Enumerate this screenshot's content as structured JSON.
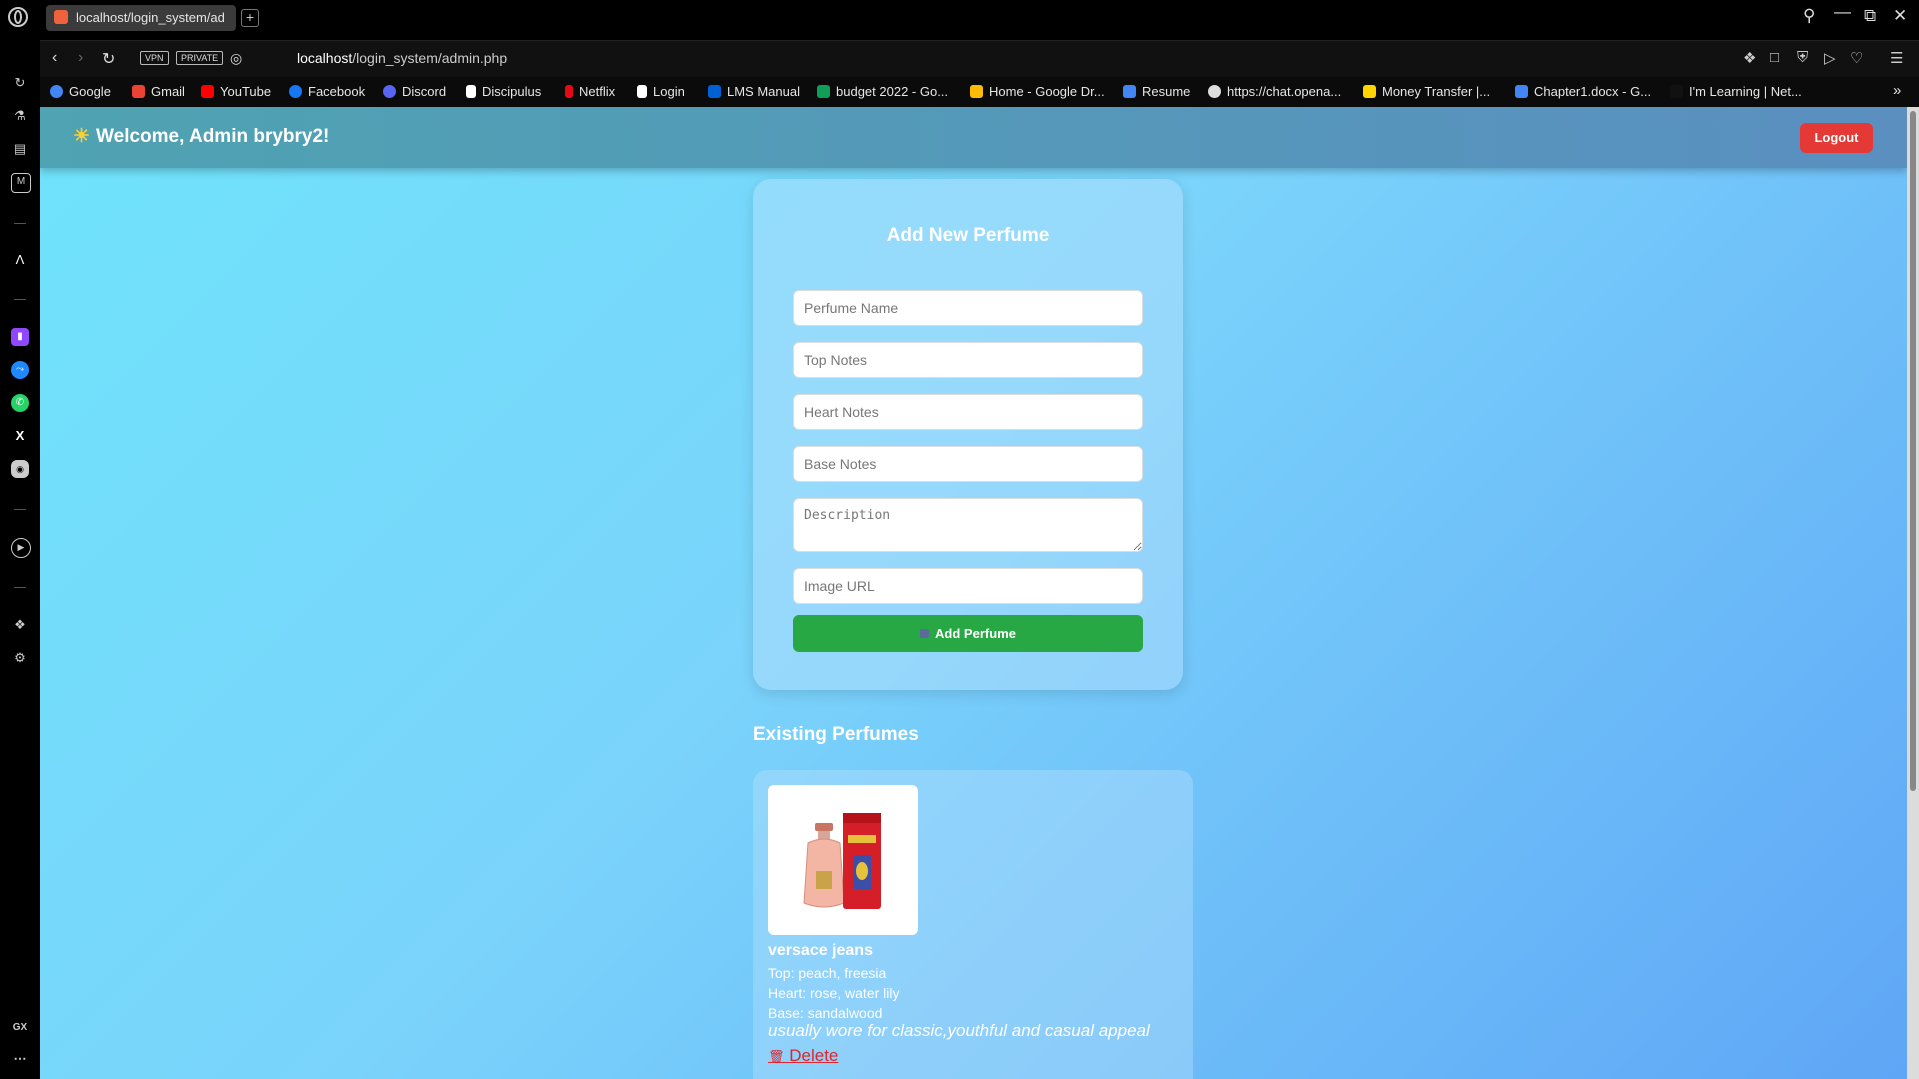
{
  "browser": {
    "tab_title": "localhost/login_system/ad",
    "new_tab": "+",
    "url_host": "localhost",
    "url_path": "/login_system/admin.php",
    "vpn_badge": "VPN",
    "private_badge": "PRIVATE",
    "bookmarks": [
      {
        "label": "Google",
        "color": "#4285f4"
      },
      {
        "label": "Gmail",
        "color": "#ea4335"
      },
      {
        "label": "YouTube",
        "color": "#ff0000"
      },
      {
        "label": "Facebook",
        "color": "#1877f2"
      },
      {
        "label": "Discord",
        "color": "#5865f2"
      },
      {
        "label": "Discipulus",
        "color": "#ffffff"
      },
      {
        "label": "Netflix",
        "color": "#e50914"
      },
      {
        "label": "Login",
        "color": "#ffffff"
      },
      {
        "label": "LMS Manual",
        "color": "#0061d5"
      },
      {
        "label": "budget 2022 - Go...",
        "color": "#0f9d58"
      },
      {
        "label": "Home - Google Dr...",
        "color": "#fbbc04"
      },
      {
        "label": "Resume",
        "color": "#4285f4"
      },
      {
        "label": "https://chat.opena...",
        "color": "#dddddd"
      },
      {
        "label": "Money Transfer |...",
        "color": "#ffd400"
      },
      {
        "label": "Chapter1.docx - G...",
        "color": "#4285f4"
      },
      {
        "label": "I'm Learning | Net...",
        "color": "#111111"
      }
    ],
    "more_bookmarks": "»"
  },
  "page": {
    "welcome": "Welcome, Admin brybry2!",
    "logout_label": "Logout",
    "form": {
      "title": "Add New Perfume",
      "name_placeholder": "Perfume Name",
      "top_placeholder": "Top Notes",
      "heart_placeholder": "Heart Notes",
      "base_placeholder": "Base Notes",
      "description_placeholder": "Description",
      "image_placeholder": "Image URL",
      "submit_label": "Add Perfume"
    },
    "existing_title": "Existing Perfumes",
    "perfumes": [
      {
        "name": "versace jeans",
        "top": "Top: peach, freesia",
        "heart": "Heart: rose, water lily",
        "base": "Base: sandalwood",
        "description": "usually wore for classic,youthful and casual appeal",
        "delete_label": "Delete"
      }
    ]
  },
  "colors": {
    "logout": "#e53935",
    "add_button": "#28a745",
    "delete_link": "#e0242d"
  }
}
